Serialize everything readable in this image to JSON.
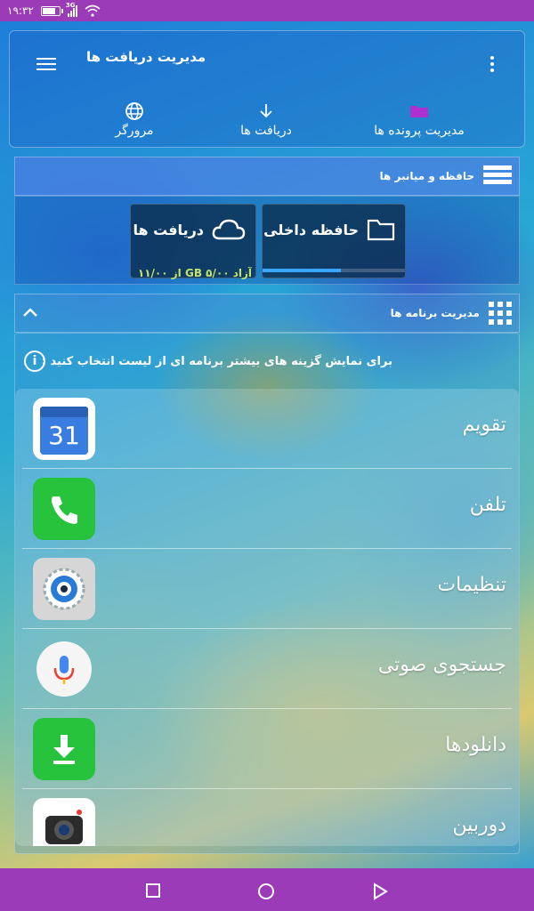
{
  "status_bar": {
    "time": "۱۹:۳۲",
    "network": "3G"
  },
  "header": {
    "title": "مدیریت دریافت ها",
    "tabs": [
      {
        "label": "مرورگر",
        "icon": "globe-icon"
      },
      {
        "label": "دریافت ها",
        "icon": "download-arrow-icon"
      },
      {
        "label": "مدیریت پرونده ها",
        "icon": "folder-icon",
        "icon_color": "#b02fd0"
      }
    ]
  },
  "storage_section": {
    "title": "حافظه و میانبر ها",
    "internal": {
      "label": "حافظه داخلی",
      "used_fraction": 0.55
    },
    "downloads": {
      "label": "دریافت ها",
      "free_text": "آزاد ۵/۰۰ GB از ۱۱/۰۰"
    }
  },
  "apps_section": {
    "title": "مدیریت برنامه ها",
    "info": "برای نمایش گزینه های بیشتر برنامه ای از لیست انتخاب کنید :",
    "apps": [
      {
        "name": "تقویم",
        "icon": "calendar-icon",
        "icon_text": "31"
      },
      {
        "name": "تلفن",
        "icon": "phone-icon"
      },
      {
        "name": "تنظیمات",
        "icon": "settings-icon"
      },
      {
        "name": "جستجوی صوتی",
        "icon": "mic-icon"
      },
      {
        "name": "دانلودها",
        "icon": "downloads-icon"
      },
      {
        "name": "دوربین",
        "icon": "camera-icon"
      }
    ]
  },
  "colors": {
    "status_bar": "#9b3bb8",
    "nav_bar": "#9b3bb8",
    "accent": "#3aa6ff"
  }
}
